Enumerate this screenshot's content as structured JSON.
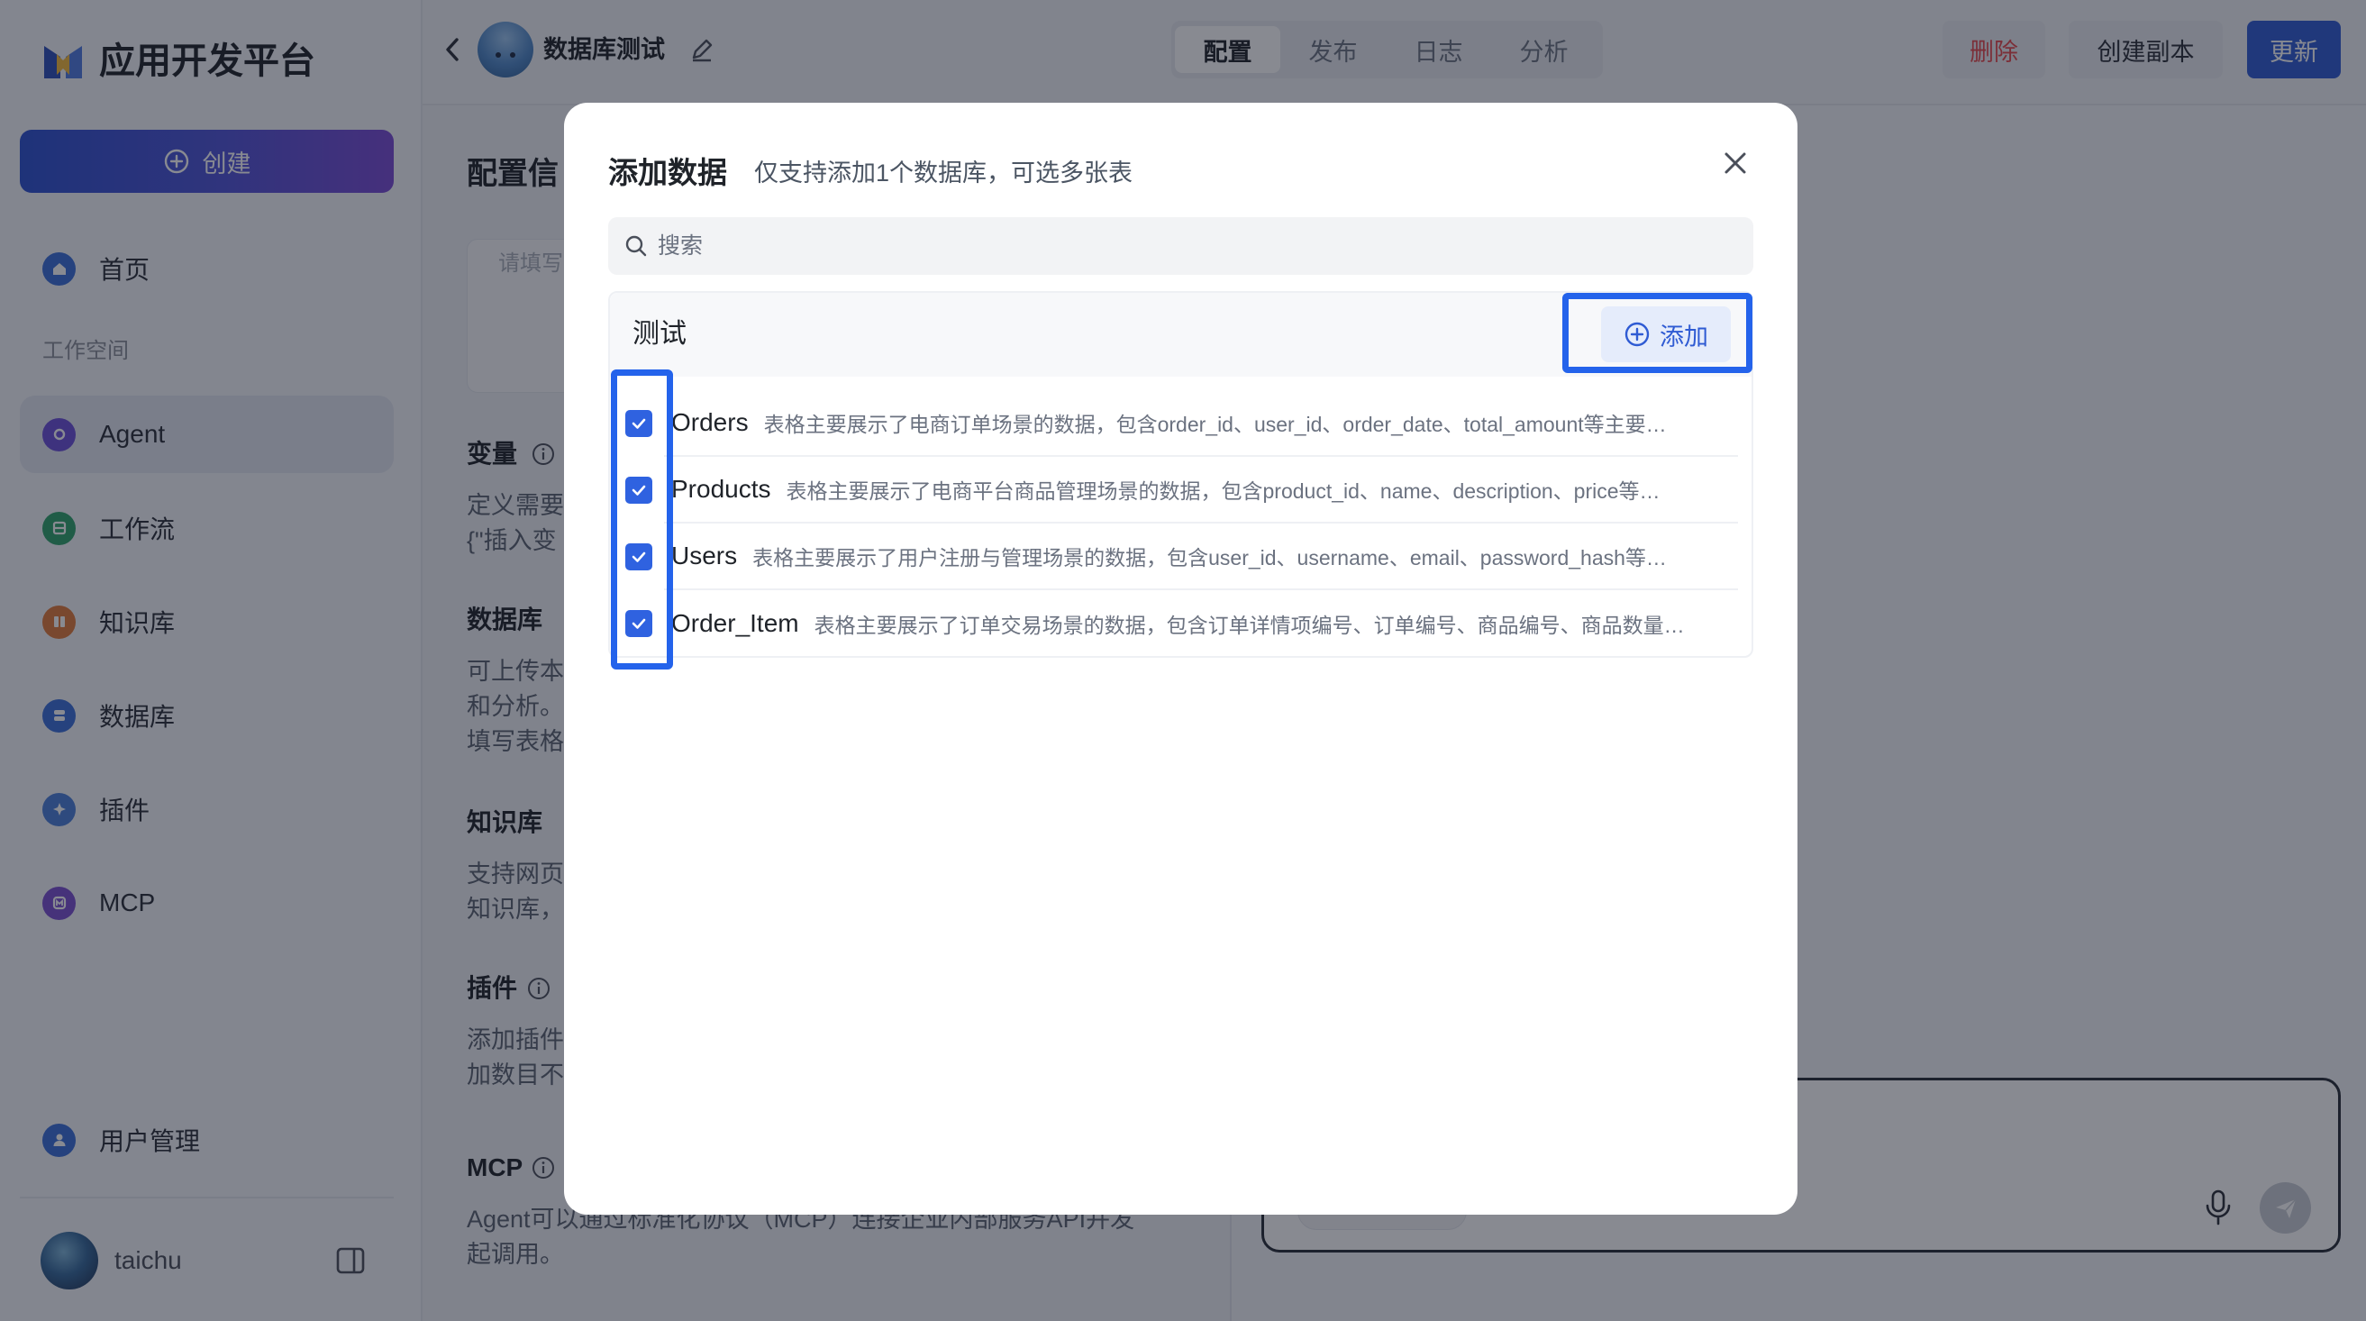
{
  "app": {
    "title": "应用开发平台",
    "create_label": "创建"
  },
  "sidebar": {
    "home": {
      "label": "首页",
      "icon": "home-icon",
      "color": "#3b6fd8"
    },
    "workspace_label": "工作空间",
    "items": [
      {
        "label": "Agent",
        "icon": "agent-icon",
        "color": "#6b4fd8",
        "active": true
      },
      {
        "label": "工作流",
        "icon": "workflow-icon",
        "color": "#2fa36b",
        "active": false
      },
      {
        "label": "知识库",
        "icon": "knowledge-base-icon",
        "color": "#e07b3a",
        "active": false
      },
      {
        "label": "数据库",
        "icon": "database-icon",
        "color": "#3b6fd8",
        "active": false
      },
      {
        "label": "插件",
        "icon": "plugin-icon",
        "color": "#4a7fd8",
        "active": false
      },
      {
        "label": "MCP",
        "icon": "mcp-icon",
        "color": "#7a4fd0",
        "active": false
      }
    ],
    "user_management": {
      "label": "用户管理",
      "icon": "user-management-icon",
      "color": "#3b6fd8"
    },
    "user": {
      "name": "taichu"
    }
  },
  "header": {
    "app_name": "数据库测试",
    "tabs": [
      {
        "label": "配置",
        "active": true
      },
      {
        "label": "发布",
        "active": false
      },
      {
        "label": "日志",
        "active": false
      },
      {
        "label": "分析",
        "active": false
      }
    ],
    "delete_label": "删除",
    "duplicate_label": "创建副本",
    "update_label": "更新"
  },
  "config": {
    "title": "配置信",
    "prompt_placeholder": "请填写",
    "variables": {
      "heading": "变量",
      "lines": [
        "定义需要",
        "{\"插入变"
      ]
    },
    "database": {
      "heading": "数据库",
      "lines": [
        "可上传本",
        "和分析。",
        "填写表格"
      ]
    },
    "knowledge": {
      "heading": "知识库",
      "lines": [
        "支持网页",
        "知识库，"
      ]
    },
    "plugins": {
      "heading": "插件",
      "lines": [
        "添加插件",
        "加数目不"
      ]
    },
    "mcp": {
      "heading": "MCP",
      "lines": [
        "Agent可以通过标准化协议（MCP）连接企业内部服务API并发",
        "起调用。"
      ]
    }
  },
  "modal": {
    "title": "添加数据",
    "subtitle": "仅支持添加1个数据库，可选多张表",
    "search_placeholder": "搜索",
    "database": {
      "name": "测试",
      "add_label": "添加",
      "tables": [
        {
          "name": "Orders",
          "description": "表格主要展示了电商订单场景的数据，包含order_id、user_id、order_date、total_amount等主要…",
          "checked": true
        },
        {
          "name": "Products",
          "description": "表格主要展示了电商平台商品管理场景的数据，包含product_id、name、description、price等…",
          "checked": true
        },
        {
          "name": "Users",
          "description": "表格主要展示了用户注册与管理场景的数据，包含user_id、username、email、password_hash等…",
          "checked": true
        },
        {
          "name": "Order_Item",
          "description": "表格主要展示了订单交易场景的数据，包含订单详情项编号、订单编号、商品编号、商品数量…",
          "checked": true
        }
      ]
    }
  },
  "colors": {
    "accent": "#2f5bd3",
    "danger": "#e5484d",
    "highlight": "#2463eb",
    "checkbox": "#2f62e0"
  }
}
